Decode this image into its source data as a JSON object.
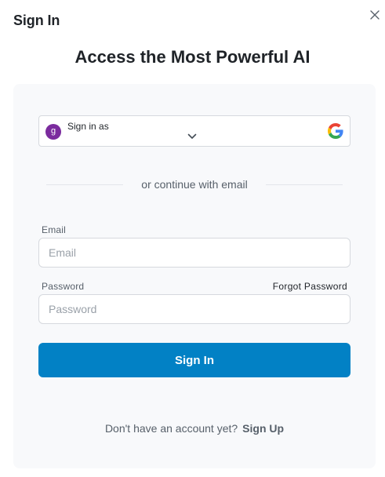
{
  "dialog": {
    "title": "Sign In",
    "headline": "Access the Most Powerful AI"
  },
  "google_account": {
    "label": "Sign in as",
    "avatar_letter": "g",
    "avatar_color": "#7b2b9e",
    "provider_icon": "google-g-icon",
    "dropdown_icon": "chevron-down-icon"
  },
  "divider": {
    "text": "or continue with email"
  },
  "form": {
    "email_label": "Email",
    "email_placeholder": "Email",
    "email_value": "",
    "password_label": "Password",
    "password_placeholder": "Password",
    "password_value": "",
    "forgot_label": "Forgot Password",
    "submit_label": "Sign In"
  },
  "footer": {
    "prompt": "Don't have an account yet?",
    "link_label": "Sign Up"
  },
  "colors": {
    "primary": "#0281c5",
    "card_background": "#f8f9fb",
    "text": "#1f2328",
    "muted_text": "#57606a"
  }
}
